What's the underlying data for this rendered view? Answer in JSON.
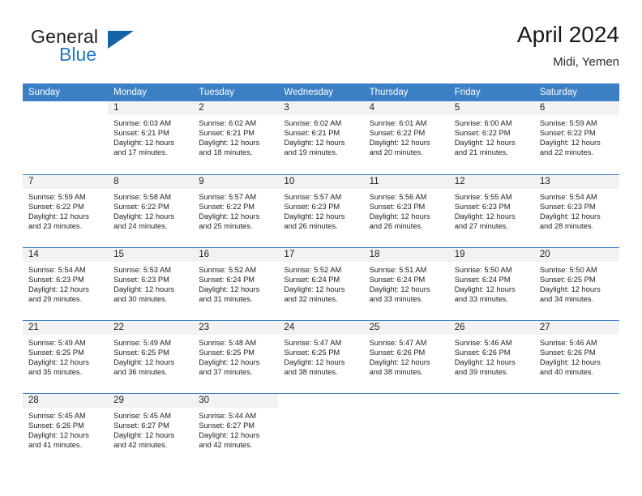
{
  "brand": {
    "name_top": "General",
    "name_bottom": "Blue",
    "triangle_color": "#1464a5",
    "blue_color": "#1f7ac4"
  },
  "header": {
    "title": "April 2024",
    "subtitle": "Midi, Yemen"
  },
  "theme": {
    "header_bg": "#3b7fc4",
    "daynum_bg": "#f2f2f2",
    "rule_color": "#3b7fc4"
  },
  "weekdays": [
    "Sunday",
    "Monday",
    "Tuesday",
    "Wednesday",
    "Thursday",
    "Friday",
    "Saturday"
  ],
  "weeks": [
    [
      {
        "day": "",
        "l1": "",
        "l2": "",
        "l3": "",
        "l4": ""
      },
      {
        "day": "1",
        "l1": "Sunrise: 6:03 AM",
        "l2": "Sunset: 6:21 PM",
        "l3": "Daylight: 12 hours",
        "l4": "and 17 minutes."
      },
      {
        "day": "2",
        "l1": "Sunrise: 6:02 AM",
        "l2": "Sunset: 6:21 PM",
        "l3": "Daylight: 12 hours",
        "l4": "and 18 minutes."
      },
      {
        "day": "3",
        "l1": "Sunrise: 6:02 AM",
        "l2": "Sunset: 6:21 PM",
        "l3": "Daylight: 12 hours",
        "l4": "and 19 minutes."
      },
      {
        "day": "4",
        "l1": "Sunrise: 6:01 AM",
        "l2": "Sunset: 6:22 PM",
        "l3": "Daylight: 12 hours",
        "l4": "and 20 minutes."
      },
      {
        "day": "5",
        "l1": "Sunrise: 6:00 AM",
        "l2": "Sunset: 6:22 PM",
        "l3": "Daylight: 12 hours",
        "l4": "and 21 minutes."
      },
      {
        "day": "6",
        "l1": "Sunrise: 5:59 AM",
        "l2": "Sunset: 6:22 PM",
        "l3": "Daylight: 12 hours",
        "l4": "and 22 minutes."
      }
    ],
    [
      {
        "day": "7",
        "l1": "Sunrise: 5:59 AM",
        "l2": "Sunset: 6:22 PM",
        "l3": "Daylight: 12 hours",
        "l4": "and 23 minutes."
      },
      {
        "day": "8",
        "l1": "Sunrise: 5:58 AM",
        "l2": "Sunset: 6:22 PM",
        "l3": "Daylight: 12 hours",
        "l4": "and 24 minutes."
      },
      {
        "day": "9",
        "l1": "Sunrise: 5:57 AM",
        "l2": "Sunset: 6:22 PM",
        "l3": "Daylight: 12 hours",
        "l4": "and 25 minutes."
      },
      {
        "day": "10",
        "l1": "Sunrise: 5:57 AM",
        "l2": "Sunset: 6:23 PM",
        "l3": "Daylight: 12 hours",
        "l4": "and 26 minutes."
      },
      {
        "day": "11",
        "l1": "Sunrise: 5:56 AM",
        "l2": "Sunset: 6:23 PM",
        "l3": "Daylight: 12 hours",
        "l4": "and 26 minutes."
      },
      {
        "day": "12",
        "l1": "Sunrise: 5:55 AM",
        "l2": "Sunset: 6:23 PM",
        "l3": "Daylight: 12 hours",
        "l4": "and 27 minutes."
      },
      {
        "day": "13",
        "l1": "Sunrise: 5:54 AM",
        "l2": "Sunset: 6:23 PM",
        "l3": "Daylight: 12 hours",
        "l4": "and 28 minutes."
      }
    ],
    [
      {
        "day": "14",
        "l1": "Sunrise: 5:54 AM",
        "l2": "Sunset: 6:23 PM",
        "l3": "Daylight: 12 hours",
        "l4": "and 29 minutes."
      },
      {
        "day": "15",
        "l1": "Sunrise: 5:53 AM",
        "l2": "Sunset: 6:23 PM",
        "l3": "Daylight: 12 hours",
        "l4": "and 30 minutes."
      },
      {
        "day": "16",
        "l1": "Sunrise: 5:52 AM",
        "l2": "Sunset: 6:24 PM",
        "l3": "Daylight: 12 hours",
        "l4": "and 31 minutes."
      },
      {
        "day": "17",
        "l1": "Sunrise: 5:52 AM",
        "l2": "Sunset: 6:24 PM",
        "l3": "Daylight: 12 hours",
        "l4": "and 32 minutes."
      },
      {
        "day": "18",
        "l1": "Sunrise: 5:51 AM",
        "l2": "Sunset: 6:24 PM",
        "l3": "Daylight: 12 hours",
        "l4": "and 33 minutes."
      },
      {
        "day": "19",
        "l1": "Sunrise: 5:50 AM",
        "l2": "Sunset: 6:24 PM",
        "l3": "Daylight: 12 hours",
        "l4": "and 33 minutes."
      },
      {
        "day": "20",
        "l1": "Sunrise: 5:50 AM",
        "l2": "Sunset: 6:25 PM",
        "l3": "Daylight: 12 hours",
        "l4": "and 34 minutes."
      }
    ],
    [
      {
        "day": "21",
        "l1": "Sunrise: 5:49 AM",
        "l2": "Sunset: 6:25 PM",
        "l3": "Daylight: 12 hours",
        "l4": "and 35 minutes."
      },
      {
        "day": "22",
        "l1": "Sunrise: 5:49 AM",
        "l2": "Sunset: 6:25 PM",
        "l3": "Daylight: 12 hours",
        "l4": "and 36 minutes."
      },
      {
        "day": "23",
        "l1": "Sunrise: 5:48 AM",
        "l2": "Sunset: 6:25 PM",
        "l3": "Daylight: 12 hours",
        "l4": "and 37 minutes."
      },
      {
        "day": "24",
        "l1": "Sunrise: 5:47 AM",
        "l2": "Sunset: 6:25 PM",
        "l3": "Daylight: 12 hours",
        "l4": "and 38 minutes."
      },
      {
        "day": "25",
        "l1": "Sunrise: 5:47 AM",
        "l2": "Sunset: 6:26 PM",
        "l3": "Daylight: 12 hours",
        "l4": "and 38 minutes."
      },
      {
        "day": "26",
        "l1": "Sunrise: 5:46 AM",
        "l2": "Sunset: 6:26 PM",
        "l3": "Daylight: 12 hours",
        "l4": "and 39 minutes."
      },
      {
        "day": "27",
        "l1": "Sunrise: 5:46 AM",
        "l2": "Sunset: 6:26 PM",
        "l3": "Daylight: 12 hours",
        "l4": "and 40 minutes."
      }
    ],
    [
      {
        "day": "28",
        "l1": "Sunrise: 5:45 AM",
        "l2": "Sunset: 6:26 PM",
        "l3": "Daylight: 12 hours",
        "l4": "and 41 minutes."
      },
      {
        "day": "29",
        "l1": "Sunrise: 5:45 AM",
        "l2": "Sunset: 6:27 PM",
        "l3": "Daylight: 12 hours",
        "l4": "and 42 minutes."
      },
      {
        "day": "30",
        "l1": "Sunrise: 5:44 AM",
        "l2": "Sunset: 6:27 PM",
        "l3": "Daylight: 12 hours",
        "l4": "and 42 minutes."
      },
      {
        "day": "",
        "l1": "",
        "l2": "",
        "l3": "",
        "l4": ""
      },
      {
        "day": "",
        "l1": "",
        "l2": "",
        "l3": "",
        "l4": ""
      },
      {
        "day": "",
        "l1": "",
        "l2": "",
        "l3": "",
        "l4": ""
      },
      {
        "day": "",
        "l1": "",
        "l2": "",
        "l3": "",
        "l4": ""
      }
    ]
  ]
}
